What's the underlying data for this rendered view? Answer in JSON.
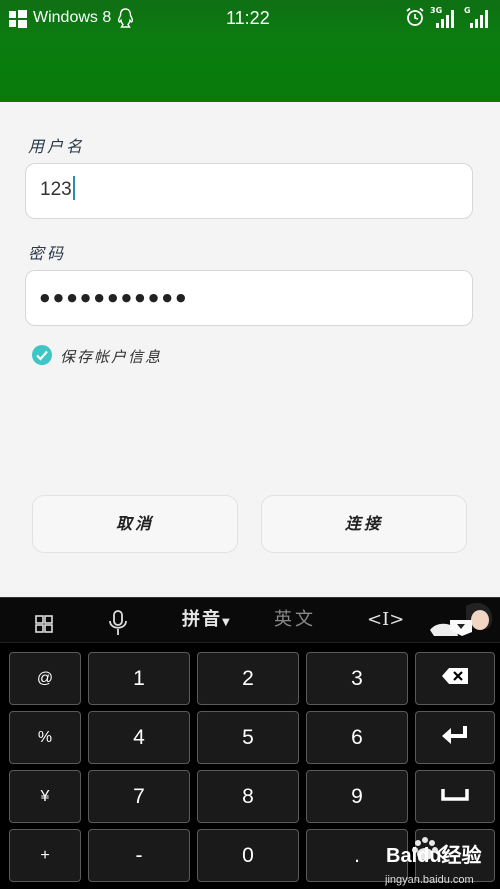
{
  "status_bar": {
    "os_label": "Windows 8",
    "time": "11:22",
    "network_1": "3G",
    "network_2": "G",
    "icons": [
      "windows-logo-icon",
      "qq-penguin-icon",
      "alarm-icon",
      "signal-icon",
      "signal-icon"
    ]
  },
  "form": {
    "username_label": "用户名",
    "username_value": "123",
    "password_label": "密码",
    "password_value": "●●●●●●●●●●●",
    "save_account_label": "保存帐户信息",
    "save_account_checked": true,
    "cancel_label": "取消",
    "connect_label": "连接"
  },
  "keyboard": {
    "toolbar": {
      "pinyin_label": "拼音",
      "english_label": "英文",
      "cursor_label": "<I>"
    },
    "rows": [
      [
        "@",
        "1",
        "2",
        "3",
        "backspace"
      ],
      [
        "%",
        "4",
        "5",
        "6",
        "enter"
      ],
      [
        "¥",
        "7",
        "8",
        "9",
        "space"
      ],
      [
        "+",
        "-",
        "0",
        ".",
        "done"
      ]
    ]
  },
  "watermark": {
    "brand": "Baidu经验",
    "url": "jingyan.baidu.com"
  },
  "colors": {
    "header_green": "#077a0b",
    "check_teal": "#3cc6c6",
    "key_bg": "#1a1a1a",
    "key_border": "#5a5a5a"
  }
}
